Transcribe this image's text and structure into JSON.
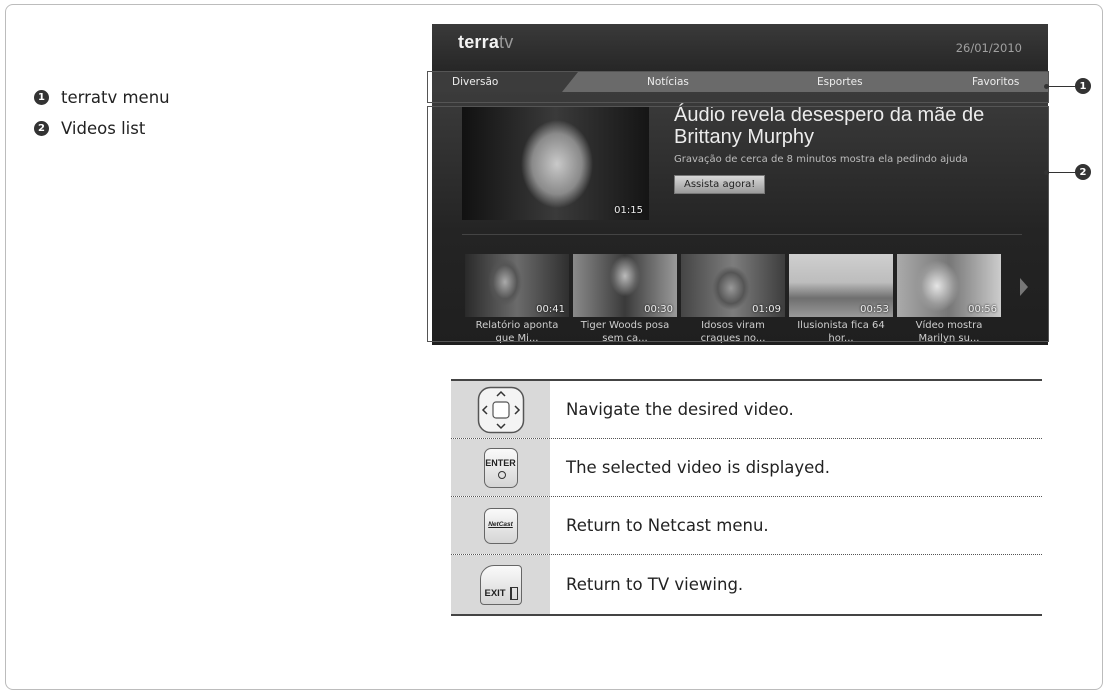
{
  "legend": {
    "items": [
      {
        "num": "1",
        "label": "terratv menu"
      },
      {
        "num": "2",
        "label": "Videos list"
      }
    ]
  },
  "tv": {
    "logo_main": "terra",
    "logo_suffix": "tv",
    "date": "26/01/2010",
    "tabs": [
      "Diversão",
      "Notícias",
      "Esportes",
      "Favoritos"
    ],
    "featured": {
      "headline": "Áudio revela desespero da mãe de Brittany Murphy",
      "subline": "Gravação de cerca de 8 minutos mostra ela pedindo ajuda",
      "button": "Assista agora!",
      "duration": "01:15"
    },
    "videos": [
      {
        "duration": "00:41",
        "title_1": "Relatório aponta",
        "title_2": "que Mi..."
      },
      {
        "duration": "00:30",
        "title_1": "Tiger Woods posa",
        "title_2": "sem ca..."
      },
      {
        "duration": "01:09",
        "title_1": "Idosos viram",
        "title_2": "craques no..."
      },
      {
        "duration": "00:53",
        "title_1": "Ilusionista fica 64",
        "title_2": "hor..."
      },
      {
        "duration": "00:56",
        "title_1": "Vídeo mostra",
        "title_2": "Marilyn su..."
      }
    ]
  },
  "callouts": {
    "one": "1",
    "two": "2"
  },
  "keys": [
    {
      "icon": "navigation-pad-icon",
      "text": "Navigate the desired video."
    },
    {
      "icon": "enter-button-icon",
      "label": "ENTER",
      "text": "The selected video is displayed."
    },
    {
      "icon": "netcast-button-icon",
      "label": "NetCast",
      "text": "Return to Netcast menu."
    },
    {
      "icon": "exit-button-icon",
      "label": "EXIT",
      "text": "Return to TV viewing."
    }
  ]
}
